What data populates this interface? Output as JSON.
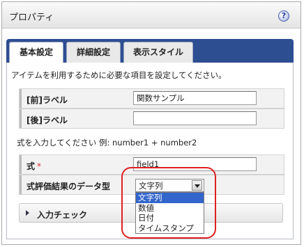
{
  "panel": {
    "title": "プロパティ",
    "help_icon": "help-icon",
    "help_glyph": "?"
  },
  "tabs": [
    {
      "label": "基本設定",
      "active": true
    },
    {
      "label": "詳細設定",
      "active": false
    },
    {
      "label": "表示スタイル",
      "active": false
    }
  ],
  "intro_text": "アイテムを利用するために必要な項目を設定してください。",
  "fields": {
    "label_before": {
      "label": "[前]ラベル",
      "value": "関数サンプル"
    },
    "label_after": {
      "label": "[後]ラベル",
      "value": ""
    }
  },
  "expression_hint": "式を入力してください 例: number1 + number2",
  "expression": {
    "label": "式",
    "required_mark": "*",
    "value": "field1"
  },
  "result_type": {
    "label": "式評価結果のデータ型",
    "selected": "文字列",
    "options": [
      "文字列",
      "数値",
      "日付",
      "タイムスタンプ"
    ]
  },
  "input_check": {
    "label": "入力チェック"
  },
  "colors": {
    "tab_bar": "#2e4e92",
    "selected_option": "#3366cc",
    "highlight": "#e02020"
  }
}
